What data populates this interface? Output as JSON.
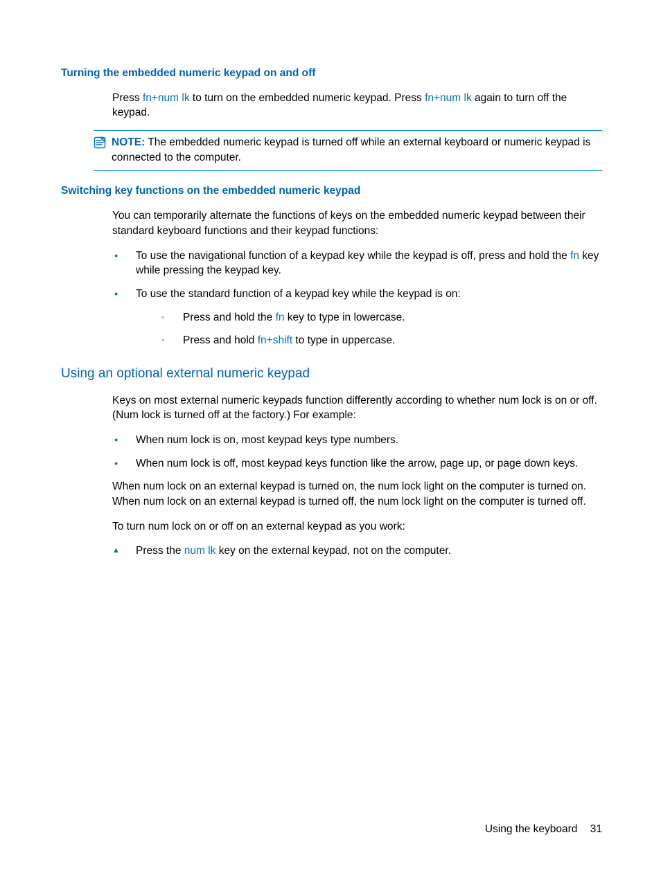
{
  "h4_turning": "Turning the embedded numeric keypad on and off",
  "p_press_pre": "Press ",
  "k_fnnumlk": "fn+num lk",
  "p_press_mid": " to turn on the embedded numeric keypad. Press ",
  "p_press_post": " again to turn off the keypad.",
  "note_label": "NOTE:",
  "note_body": " The embedded numeric keypad is turned off while an external keyboard or numeric keypad is connected to the computer.",
  "h4_switching": "Switching key functions on the embedded numeric keypad",
  "p_switch_intro": "You can temporarily alternate the functions of keys on the embedded numeric keypad between their standard keyboard functions and their keypad functions:",
  "li_nav_pre": "To use the navigational function of a keypad key while the keypad is off, press and hold the ",
  "k_fn": "fn",
  "li_nav_post": " key while pressing the keypad key.",
  "li_std": "To use the standard function of a keypad key while the keypad is on:",
  "li_lower_pre": "Press and hold the ",
  "li_lower_post": " key to type in lowercase.",
  "li_upper_pre": "Press and hold ",
  "k_fnshift": "fn+shift",
  "li_upper_post": " to type in uppercase.",
  "h3_external": "Using an optional external numeric keypad",
  "p_ext_intro": "Keys on most external numeric keypads function differently according to whether num lock is on or off. (Num lock is turned off at the factory.) For example:",
  "li_ext_on": "When num lock is on, most keypad keys type numbers.",
  "li_ext_off": "When num lock is off, most keypad keys function like the arrow, page up, or page down keys.",
  "p_ext_light": "When num lock on an external keypad is turned on, the num lock light on the computer is turned on. When num lock on an external keypad is turned off, the num lock light on the computer is turned off.",
  "p_ext_toggle": "To turn num lock on or off on an external keypad as you work:",
  "li_tri_pre": "Press the ",
  "k_numlk": "num lk",
  "li_tri_post": " key on the external keypad, not on the computer.",
  "footer_title": "Using the keyboard",
  "footer_page": "31"
}
